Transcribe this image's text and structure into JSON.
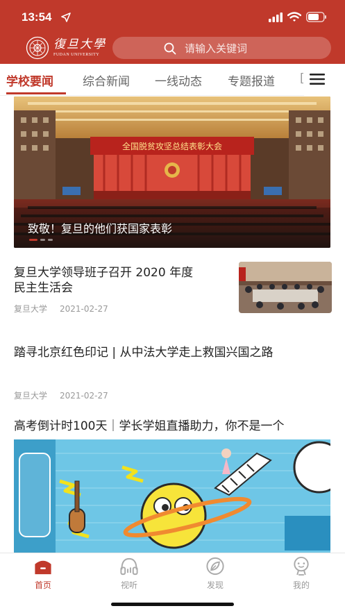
{
  "status_bar": {
    "time": "13:54",
    "icons": [
      "location-arrow-icon",
      "signal-icon",
      "wifi-icon",
      "battery-icon"
    ]
  },
  "brand": {
    "name_cn": "復旦大學",
    "name_en": "FUDAN UNIVERSITY",
    "logo": "fudan-seal-logo"
  },
  "search": {
    "placeholder": "请输入关键词"
  },
  "tabs": [
    {
      "label": "学校要闻",
      "active": true
    },
    {
      "label": "综合新闻",
      "active": false
    },
    {
      "label": "一线动态",
      "active": false
    },
    {
      "label": "专题报道",
      "active": false
    }
  ],
  "tab_partial": "[",
  "menu_icon": "hamburger-menu-icon",
  "hero": {
    "caption": "致敬！复旦的他们获国家表彰",
    "banner_text": "全国脱贫攻坚总结表彰大会",
    "slides": 3,
    "active_slide": 0
  },
  "articles": [
    {
      "title_line1": "复旦大学领导班子召开 2020 年度",
      "title_line2": "民主生活会",
      "source": "复旦大学",
      "date": "2021-02-27",
      "has_thumbnail": true
    },
    {
      "title": "踏寻北京红色印记 | 从中法大学走上救国兴国之路",
      "source": "复旦大学",
      "date": "2021-02-27",
      "has_thumbnail": false
    },
    {
      "title": "高考倒计时100天｜学长学姐直播助力，你不是一个",
      "has_image": true
    }
  ],
  "bottom_nav": [
    {
      "label": "首页",
      "icon": "home-icon",
      "active": true
    },
    {
      "label": "视听",
      "icon": "headphones-icon",
      "active": false
    },
    {
      "label": "发现",
      "icon": "compass-leaf-icon",
      "active": false
    },
    {
      "label": "我的",
      "icon": "profile-icon",
      "active": false
    }
  ],
  "colors": {
    "brand_red": "#c0392b",
    "text_primary": "#222222",
    "text_secondary": "#999999",
    "background": "#ffffff"
  }
}
